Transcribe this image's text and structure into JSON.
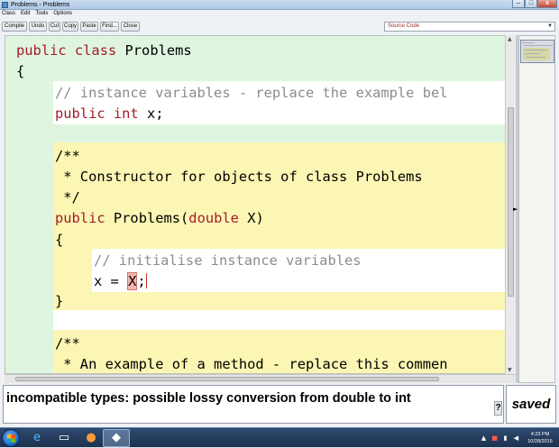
{
  "window": {
    "title": "Problems - Problems",
    "controls": {
      "minimize": "–",
      "maximize": "□",
      "close": "x"
    }
  },
  "menu": {
    "items": [
      "Class",
      "Edit",
      "Tools",
      "Options"
    ]
  },
  "toolbar": {
    "buttons": [
      "Compile",
      "Undo",
      "Cut",
      "Copy",
      "Paste",
      "Find...",
      "Close"
    ],
    "view_select": "Source Code"
  },
  "code": {
    "line1_kw1": "public",
    "line1_kw2": "class",
    "line1_name": "Problems",
    "open_brace": "{",
    "field_comment": "// instance variables - replace the example bel",
    "field_kw1": "public",
    "field_kw2": "int",
    "field_name": "x;",
    "javadoc_open": "/**",
    "javadoc_text": " * Constructor for objects of class Problems",
    "javadoc_close": " */",
    "ctor_kw": "public",
    "ctor_name": "Problems(",
    "ctor_param_type": "double",
    "ctor_param": "X)",
    "ctor_open": "{",
    "body_comment": "// initialise instance variables",
    "body_lhs": "x = ",
    "body_error_token": "X",
    "body_semicolon": ";",
    "ctor_close": "}",
    "javadoc2_open": "/**",
    "javadoc2_text": " * An example of a method - replace this commen"
  },
  "status": {
    "message": "incompatible types: possible lossy conversion from double to int",
    "help": "?",
    "saved": "saved"
  },
  "taskbar": {
    "time": "4:23 PM",
    "date": "10/28/2015"
  },
  "colors": {
    "keyword": "#a41c2a",
    "comment": "#8c8c8c",
    "class_scope": "#dff5df",
    "method_scope": "#fbf6b4",
    "error_highlight": "#f0b7b0"
  }
}
